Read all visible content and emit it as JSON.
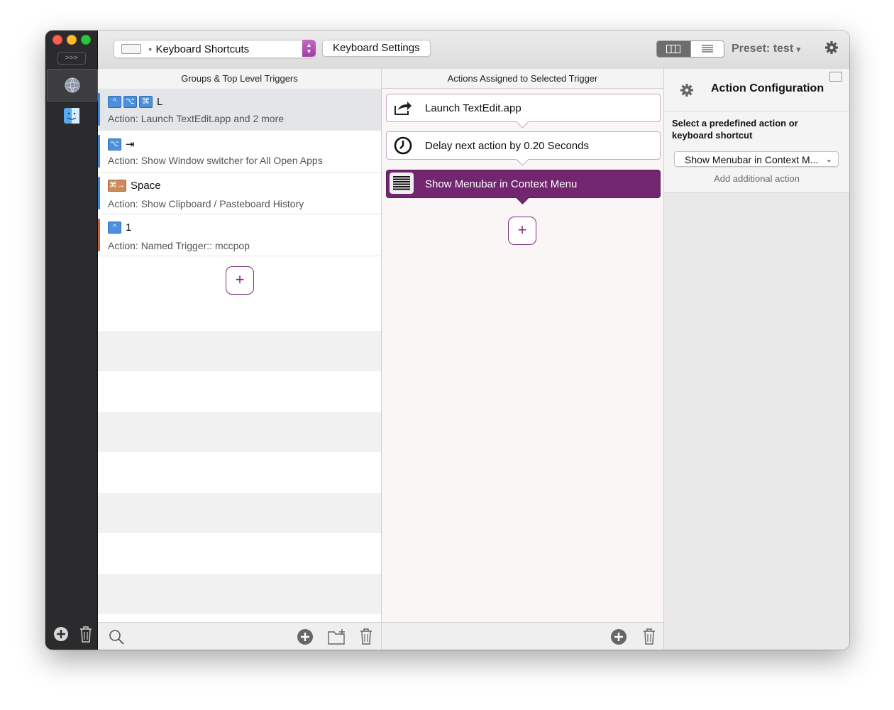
{
  "toolbar": {
    "trigger_type": "Keyboard Shortcuts",
    "settings_button": "Keyboard Settings",
    "preset_label": "Preset: test",
    "preset_chevron": "▾"
  },
  "sidebar": {
    "collapse_label": ">>>",
    "apps": [
      "global-icon",
      "finder-icon"
    ]
  },
  "groups": {
    "header": "Groups & Top Level Triggers",
    "triggers": [
      {
        "keys": [
          "^",
          "⌥",
          "⌘"
        ],
        "key": "L",
        "description": "Action: Launch TextEdit.app and 2 more",
        "color": "#3f86d8",
        "selected": true
      },
      {
        "keys": [
          "⌥"
        ],
        "key": "⇥",
        "description": "Action: Show Window switcher for All Open Apps",
        "color": "#3f86d8"
      },
      {
        "keys": [
          "⌘→"
        ],
        "key": "Space",
        "description": "Action: Show Clipboard / Pasteboard History",
        "color": "#3f86d8",
        "orange": true
      },
      {
        "keys": [
          "^"
        ],
        "key": "1",
        "description": "Action: Named Trigger:: mccpop",
        "color": "#c8603a"
      }
    ],
    "add_label": "+"
  },
  "actions": {
    "header": "Actions Assigned to Selected Trigger",
    "items": [
      {
        "label": "Launch TextEdit.app",
        "icon": "launch-icon"
      },
      {
        "label": "Delay next action by 0.20 Seconds",
        "icon": "clock-icon"
      },
      {
        "label": "Show Menubar in Context Menu",
        "icon": "menubar-icon",
        "selected": true
      }
    ],
    "add_label": "+"
  },
  "config": {
    "title": "Action Configuration",
    "hint": "Select a predefined action or keyboard shortcut",
    "selected_action": "Show Menubar in Context M...",
    "add_additional": "Add additional action"
  },
  "colors": {
    "accent": "#72266f",
    "keycap": "#4c8fdc"
  }
}
